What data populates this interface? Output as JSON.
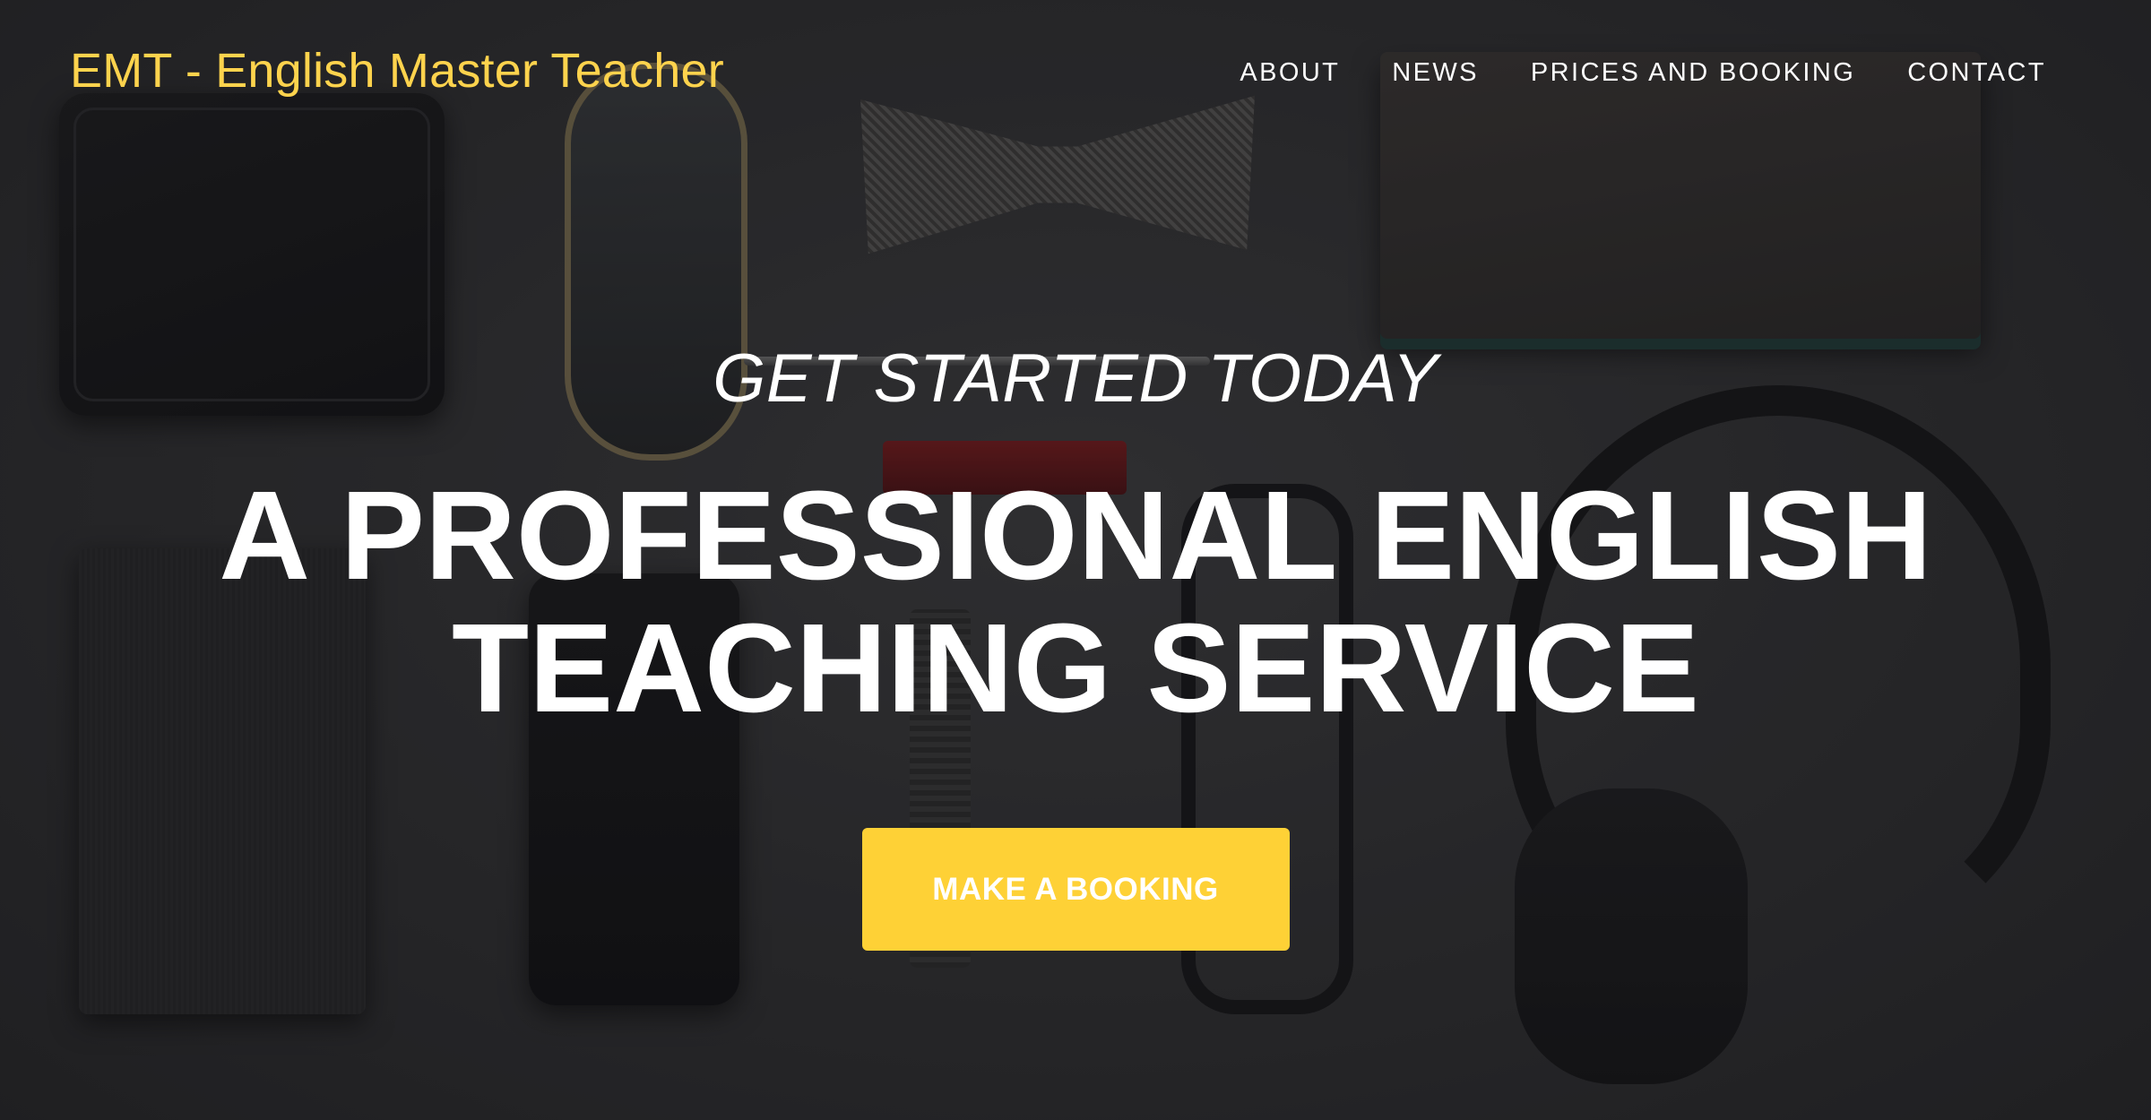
{
  "navbar": {
    "brand": "EMT - English Master Teacher",
    "links": [
      {
        "label": "ABOUT"
      },
      {
        "label": "NEWS"
      },
      {
        "label": "PRICES AND BOOKING"
      },
      {
        "label": "CONTACT"
      }
    ]
  },
  "masthead": {
    "subheading": "GET STARTED TODAY",
    "heading": "A PROFESSIONAL ENGLISH TEACHING SERVICE",
    "cta_label": "MAKE A BOOKING"
  },
  "colors": {
    "brand": "#fed34d",
    "cta_background": "#fed136",
    "text": "#ffffff"
  }
}
